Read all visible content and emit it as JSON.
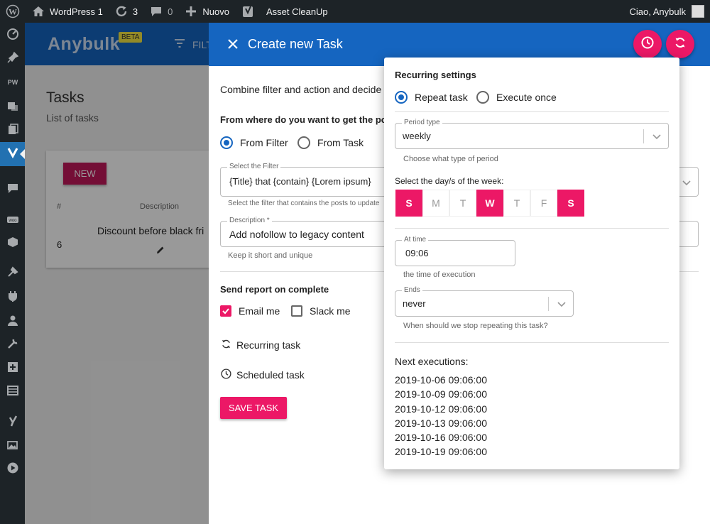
{
  "admin_bar": {
    "site_name": "WordPress 1",
    "updates_count": "3",
    "comments_count": "0",
    "new_label": "Nuovo",
    "plugin_label": "Asset CleanUp",
    "greeting": "Ciao, Anybulk"
  },
  "wp_menu": {
    "icons": [
      "dashboard-icon",
      "pin-icon",
      "pw-icon",
      "media-icon",
      "pages-icon",
      "anybulk-icon",
      "comments-icon",
      "woo-icon",
      "products-icon",
      "appearance-icon",
      "plugins-icon",
      "users-icon",
      "tools-icon",
      "settings-icon",
      "table-icon",
      "yoast-icon",
      "gallery-icon",
      "play-icon"
    ],
    "active_index": 5
  },
  "app": {
    "logo": "Anybulk",
    "beta": "BETA",
    "nav_filter": "FILT",
    "page_title": "Tasks",
    "page_subtitle": "List of tasks",
    "new_button": "NEW",
    "table": {
      "headers": [
        "#",
        "Description"
      ],
      "rows": [
        {
          "id": "6",
          "description": "Discount before black fri"
        }
      ]
    }
  },
  "dialog": {
    "title": "Create new Task",
    "intro": "Combine filter and action and decide",
    "source_question": "From where do you want to get the post",
    "source_options": [
      "From Filter",
      "From Task"
    ],
    "source_selected": 0,
    "filter_field": {
      "label": "Select the Filter",
      "value": "{Title} that {contain} {Lorem ipsum}",
      "hint": "Select the filter that contains the posts to update"
    },
    "description_field": {
      "label": "Description *",
      "value": "Add nofollow to legacy content",
      "hint": "Keep it short and unique"
    },
    "report_title": "Send report on complete",
    "report_options": [
      {
        "label": "Email me",
        "checked": true
      },
      {
        "label": "Slack me",
        "checked": false
      }
    ],
    "recurring_link": "Recurring task",
    "scheduled_link": "Scheduled task",
    "save_button": "SAVE TASK"
  },
  "recurring": {
    "title": "Recurring settings",
    "mode_options": [
      "Repeat task",
      "Execute once"
    ],
    "mode_selected": 0,
    "period": {
      "label": "Period type",
      "value": "weekly",
      "hint": "Choose what type of period"
    },
    "days_label": "Select the day/s of the week:",
    "days": [
      {
        "letter": "S",
        "on": true
      },
      {
        "letter": "M",
        "on": false
      },
      {
        "letter": "T",
        "on": false
      },
      {
        "letter": "W",
        "on": true
      },
      {
        "letter": "T",
        "on": false
      },
      {
        "letter": "F",
        "on": false
      },
      {
        "letter": "S",
        "on": true
      }
    ],
    "time": {
      "label": "At time",
      "value": "09:06",
      "hint": "the time of execution"
    },
    "ends": {
      "label": "Ends",
      "value": "never",
      "hint": "When should we stop repeating this task?"
    },
    "next_title": "Next executions:",
    "next_executions": [
      "2019-10-06 09:06:00",
      "2019-10-09 09:06:00",
      "2019-10-12 09:06:00",
      "2019-10-13 09:06:00",
      "2019-10-16 09:06:00",
      "2019-10-19 09:06:00"
    ]
  },
  "colors": {
    "primary": "#1565c0",
    "accent": "#ec1866",
    "wp_dark": "#1d2327"
  }
}
